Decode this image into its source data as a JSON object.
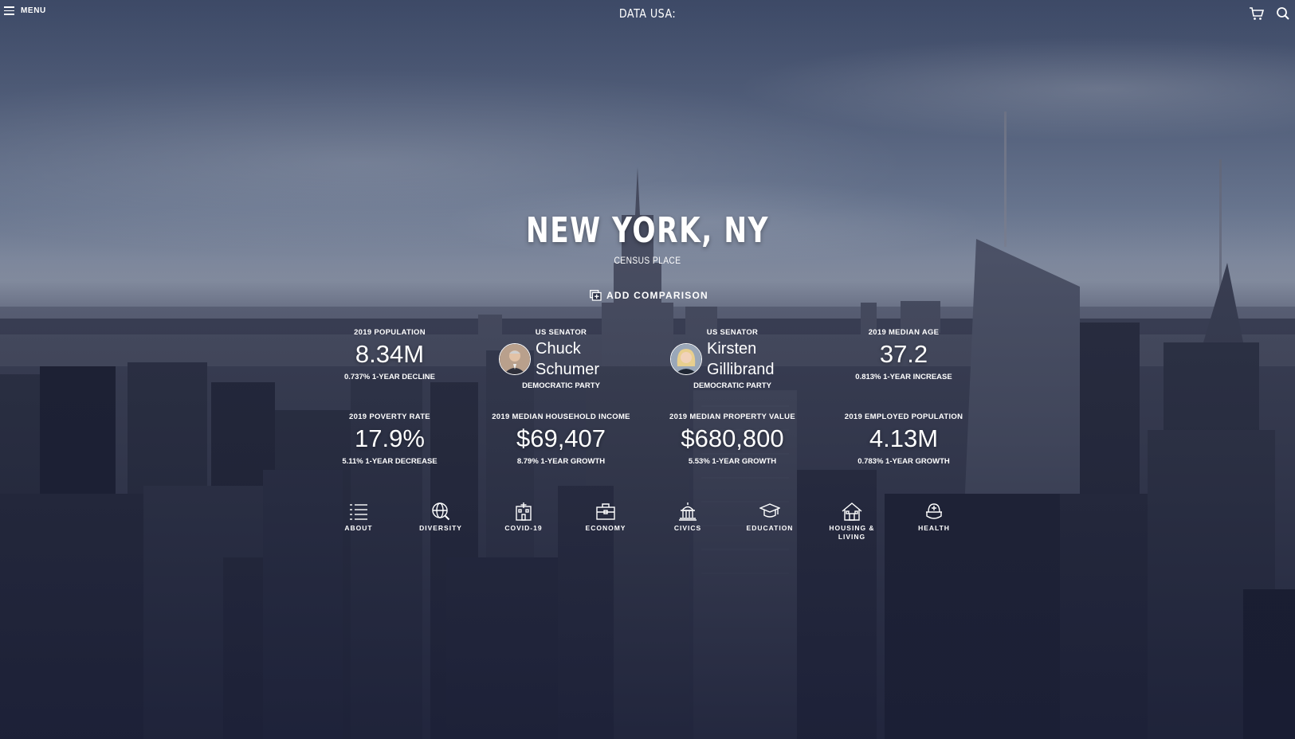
{
  "header": {
    "menu_label": "MENU",
    "logo": "DATA USA:",
    "icons": [
      "cart-icon",
      "search-icon"
    ]
  },
  "hero": {
    "title": "NEW YORK, NY",
    "subtitle": "CENSUS PLACE",
    "add_comparison": "ADD COMPARISON"
  },
  "stats_row1": [
    {
      "label": "2019 POPULATION",
      "value": "8.34M",
      "sub": "0.737% 1-YEAR DECLINE"
    },
    {
      "label": "2019 MEDIAN AGE",
      "value": "37.2",
      "sub": "0.813% 1-YEAR INCREASE"
    }
  ],
  "senators": [
    {
      "label": "US SENATOR",
      "first": "Chuck",
      "last": "Schumer",
      "party": "DEMOCRATIC PARTY"
    },
    {
      "label": "US SENATOR",
      "first": "Kirsten",
      "last": "Gillibrand",
      "party": "DEMOCRATIC PARTY"
    }
  ],
  "stats_row2": [
    {
      "label": "2019 POVERTY RATE",
      "value": "17.9%",
      "sub": "5.11% 1-YEAR DECREASE"
    },
    {
      "label": "2019 MEDIAN HOUSEHOLD INCOME",
      "value": "$69,407",
      "sub": "8.79% 1-YEAR GROWTH"
    },
    {
      "label": "2019 MEDIAN PROPERTY VALUE",
      "value": "$680,800",
      "sub": "5.53% 1-YEAR GROWTH"
    },
    {
      "label": "2019 EMPLOYED POPULATION",
      "value": "4.13M",
      "sub": "0.783% 1-YEAR GROWTH"
    }
  ],
  "topics": [
    {
      "label": "ABOUT",
      "icon": "list-icon"
    },
    {
      "label": "DIVERSITY",
      "icon": "globe-magnifier-icon"
    },
    {
      "label": "COVID-19",
      "icon": "hospital-icon"
    },
    {
      "label": "ECONOMY",
      "icon": "briefcase-icon"
    },
    {
      "label": "CIVICS",
      "icon": "capitol-icon"
    },
    {
      "label": "EDUCATION",
      "icon": "graduation-cap-icon"
    },
    {
      "label": "HOUSING & LIVING",
      "icon": "house-icon"
    },
    {
      "label": "HEALTH",
      "icon": "heart-hand-icon"
    }
  ],
  "colors": {
    "background": "#1f2740",
    "text": "#ffffff"
  }
}
